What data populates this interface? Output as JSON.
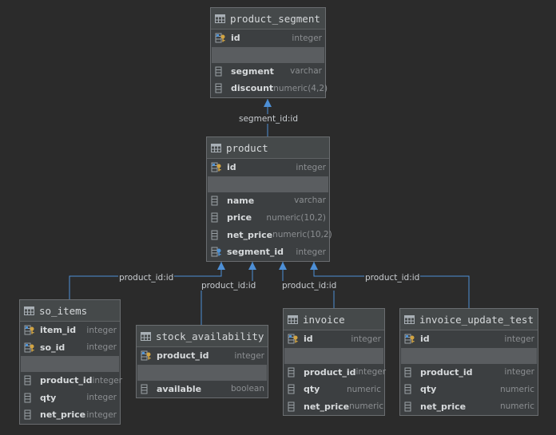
{
  "tables": [
    {
      "id": "product_segment",
      "name": "product_segment",
      "pk": [
        {
          "name": "id",
          "type": "integer",
          "icon": "primary-key-icon"
        }
      ],
      "cols": [
        {
          "name": "segment",
          "type": "varchar",
          "icon": "column-icon"
        },
        {
          "name": "discount",
          "type": "numeric(4,2)",
          "icon": "column-icon"
        }
      ]
    },
    {
      "id": "product",
      "name": "product",
      "pk": [
        {
          "name": "id",
          "type": "integer",
          "icon": "primary-key-icon"
        }
      ],
      "cols": [
        {
          "name": "name",
          "type": "varchar",
          "icon": "column-icon"
        },
        {
          "name": "price",
          "type": "numeric(10,2)",
          "icon": "column-icon"
        },
        {
          "name": "net_price",
          "type": "numeric(10,2)",
          "icon": "column-icon"
        },
        {
          "name": "segment_id",
          "type": "integer",
          "icon": "foreign-key-icon"
        }
      ]
    },
    {
      "id": "so_items",
      "name": "so_items",
      "pk": [
        {
          "name": "item_id",
          "type": "integer",
          "icon": "primary-key-icon"
        },
        {
          "name": "so_id",
          "type": "integer",
          "icon": "primary-key-icon"
        }
      ],
      "cols": [
        {
          "name": "product_id",
          "type": "integer",
          "icon": "column-icon"
        },
        {
          "name": "qty",
          "type": "integer",
          "icon": "column-icon"
        },
        {
          "name": "net_price",
          "type": "integer",
          "icon": "column-icon"
        }
      ]
    },
    {
      "id": "stock_availability",
      "name": "stock_availability",
      "pk": [
        {
          "name": "product_id",
          "type": "integer",
          "icon": "primary-key-icon"
        }
      ],
      "cols": [
        {
          "name": "available",
          "type": "boolean",
          "icon": "column-icon"
        }
      ]
    },
    {
      "id": "invoice",
      "name": "invoice",
      "pk": [
        {
          "name": "id",
          "type": "integer",
          "icon": "primary-key-icon"
        }
      ],
      "cols": [
        {
          "name": "product_id",
          "type": "integer",
          "icon": "column-icon"
        },
        {
          "name": "qty",
          "type": "numeric",
          "icon": "column-icon"
        },
        {
          "name": "net_price",
          "type": "numeric",
          "icon": "column-icon"
        }
      ]
    },
    {
      "id": "invoice_update_test",
      "name": "invoice_update_test",
      "pk": [
        {
          "name": "id",
          "type": "integer",
          "icon": "primary-key-icon"
        }
      ],
      "cols": [
        {
          "name": "product_id",
          "type": "integer",
          "icon": "column-icon"
        },
        {
          "name": "qty",
          "type": "numeric",
          "icon": "column-icon"
        },
        {
          "name": "net_price",
          "type": "numeric",
          "icon": "column-icon"
        }
      ]
    }
  ],
  "relations": [
    {
      "from": "product",
      "to": "product_segment",
      "label": "segment_id:id"
    },
    {
      "from": "so_items",
      "to": "product",
      "label": "product_id:id"
    },
    {
      "from": "stock_availability",
      "to": "product",
      "label": "product_id:id"
    },
    {
      "from": "invoice",
      "to": "product",
      "label": "product_id:id"
    },
    {
      "from": "invoice_update_test",
      "to": "product",
      "label": "product_id:id"
    }
  ],
  "colors": {
    "background": "#2b2b2b",
    "table_body": "#3c3f41",
    "table_header": "#45494a",
    "border": "#6a6d70",
    "relation_line": "#4d8fd6",
    "key_gold": "#d2a442",
    "key_blue": "#4f93d6"
  }
}
